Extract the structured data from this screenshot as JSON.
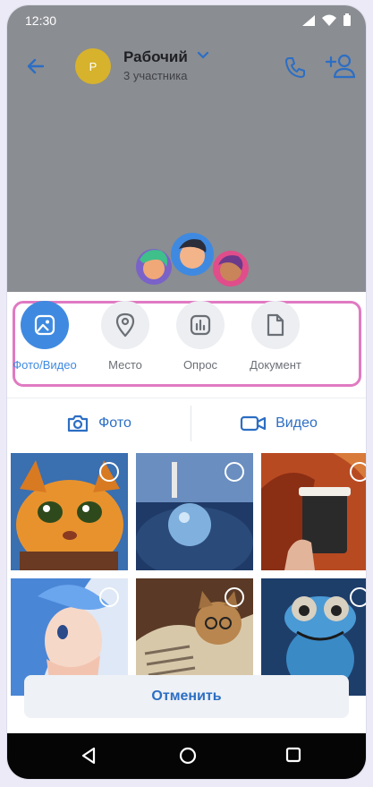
{
  "status": {
    "time": "12:30"
  },
  "header": {
    "title": "Рабочий",
    "subtitle": "3 участника",
    "avatar_letter": "Р"
  },
  "attachments": [
    {
      "label": "Фото/Видео",
      "icon": "image-icon",
      "active": true
    },
    {
      "label": "Место",
      "icon": "location-pin-icon",
      "active": false
    },
    {
      "label": "Опрос",
      "icon": "poll-icon",
      "active": false
    },
    {
      "label": "Документ",
      "icon": "document-icon",
      "active": false
    }
  ],
  "tabs": {
    "photo": "Фото",
    "video": "Видео"
  },
  "gallery": [
    {
      "name": "cat-in-boots"
    },
    {
      "name": "lighthouse-sphere"
    },
    {
      "name": "coffee-cup-autumn"
    },
    {
      "name": "anime-girl"
    },
    {
      "name": "cat-with-newspaper"
    },
    {
      "name": "frog-aviator"
    }
  ],
  "cancel_label": "Отменить",
  "colors": {
    "accent": "#3f8ae0",
    "highlight": "#e07ac2",
    "overlay": "#8a8d92"
  }
}
